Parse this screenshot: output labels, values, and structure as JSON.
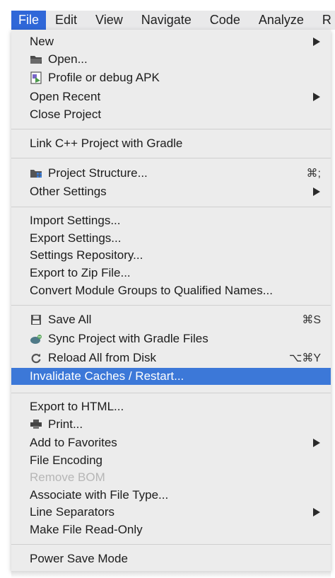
{
  "menubar": {
    "items": [
      "File",
      "Edit",
      "View",
      "Navigate",
      "Code",
      "Analyze",
      "R"
    ]
  },
  "menu": {
    "items": {
      "new": {
        "label": "New"
      },
      "open": {
        "label": "Open..."
      },
      "profile": {
        "label": "Profile or debug APK"
      },
      "open_recent": {
        "label": "Open Recent"
      },
      "close_project": {
        "label": "Close Project"
      },
      "link_cpp": {
        "label": "Link C++ Project with Gradle"
      },
      "project_structure": {
        "label": "Project Structure...",
        "shortcut": "⌘;"
      },
      "other_settings": {
        "label": "Other Settings"
      },
      "import_settings": {
        "label": "Import Settings..."
      },
      "export_settings": {
        "label": "Export Settings..."
      },
      "settings_repo": {
        "label": "Settings Repository..."
      },
      "export_zip": {
        "label": "Export to Zip File..."
      },
      "convert_module": {
        "label": "Convert Module Groups to Qualified Names..."
      },
      "save_all": {
        "label": "Save All",
        "shortcut": "⌘S"
      },
      "sync_gradle": {
        "label": "Sync Project with Gradle Files"
      },
      "reload_disk": {
        "label": "Reload All from Disk",
        "shortcut": "⌥⌘Y"
      },
      "invalidate": {
        "label": "Invalidate Caches / Restart..."
      },
      "export_html": {
        "label": "Export to HTML..."
      },
      "print": {
        "label": "Print..."
      },
      "favorites": {
        "label": "Add to Favorites"
      },
      "file_encoding": {
        "label": "File Encoding"
      },
      "remove_bom": {
        "label": "Remove BOM"
      },
      "associate": {
        "label": "Associate with File Type..."
      },
      "line_sep": {
        "label": "Line Separators"
      },
      "read_only": {
        "label": "Make File Read-Only"
      },
      "power_save": {
        "label": "Power Save Mode"
      }
    }
  },
  "colors": {
    "selection": "#3c78d8",
    "menubar_active": "#2f67d8",
    "menu_bg": "#ececec",
    "disabled_text": "#b6b6b6"
  }
}
